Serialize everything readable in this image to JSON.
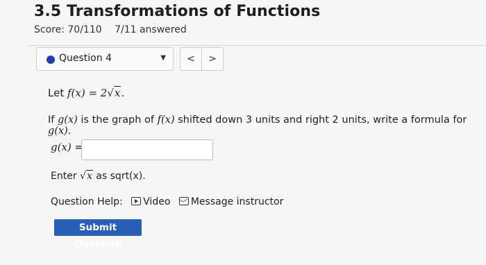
{
  "header": {
    "title": "3.5 Transformations of Functions",
    "score": "Score: 70/110",
    "answered": "7/11 answered"
  },
  "question_nav": {
    "selected": "Question 4",
    "prev_label": "<",
    "next_label": ">",
    "status_color": "#1f3ea6"
  },
  "problem": {
    "let_text": "Let ",
    "f_def": "f(x) = 2",
    "radicand": "x",
    "let_end": ".",
    "if_prefix": "If ",
    "g_of_x": "g(x)",
    "is_graph_of": " is the graph of ",
    "f_of_x": "f(x)",
    "shift_text": " shifted down 3 units and right 2 units, write a formula for ",
    "g_of_x2": "g(x)",
    "end_period": "."
  },
  "answer": {
    "label": "g(x)",
    "equals": " =",
    "value": "",
    "placeholder": ""
  },
  "hint": {
    "enter": "Enter ",
    "radicand": "x",
    "rest": " as sqrt(x)."
  },
  "help": {
    "label": "Question Help:",
    "video": "Video",
    "message": "Message instructor"
  },
  "submit": {
    "label": "Submit Question",
    "color": "#2a5fb8"
  }
}
